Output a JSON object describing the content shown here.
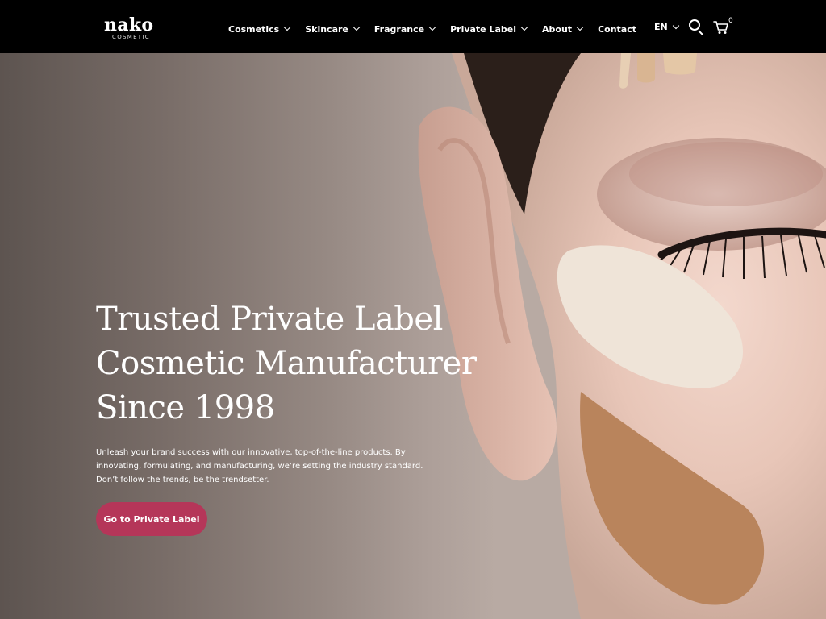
{
  "brand": {
    "name": "nako",
    "tagline": "COSMETIC"
  },
  "nav": [
    {
      "label": "Cosmetics",
      "has_dropdown": true
    },
    {
      "label": "Skincare",
      "has_dropdown": true
    },
    {
      "label": "Fragrance",
      "has_dropdown": true
    },
    {
      "label": "Private Label",
      "has_dropdown": true
    },
    {
      "label": "About",
      "has_dropdown": true
    },
    {
      "label": "Contact",
      "has_dropdown": false
    }
  ],
  "header_actions": {
    "language": "EN",
    "cart_count": "0"
  },
  "hero": {
    "headline_lines": [
      "Trusted Private Label",
      "Cosmetic Manufacturer",
      "Since 1998"
    ],
    "subtext": "Unleash your brand success with our innovative, top-of-the-line products. By innovating, formulating, and manufacturing, we’re setting the industry standard. Don’t follow the trends, be the trendsetter.",
    "cta_label": "Go to Private Label"
  },
  "colors": {
    "header_bg": "#000000",
    "cta_bg": "#b53659",
    "text": "#ffffff"
  },
  "icons": [
    "search-icon",
    "cart-icon",
    "chevron-down-icon"
  ]
}
